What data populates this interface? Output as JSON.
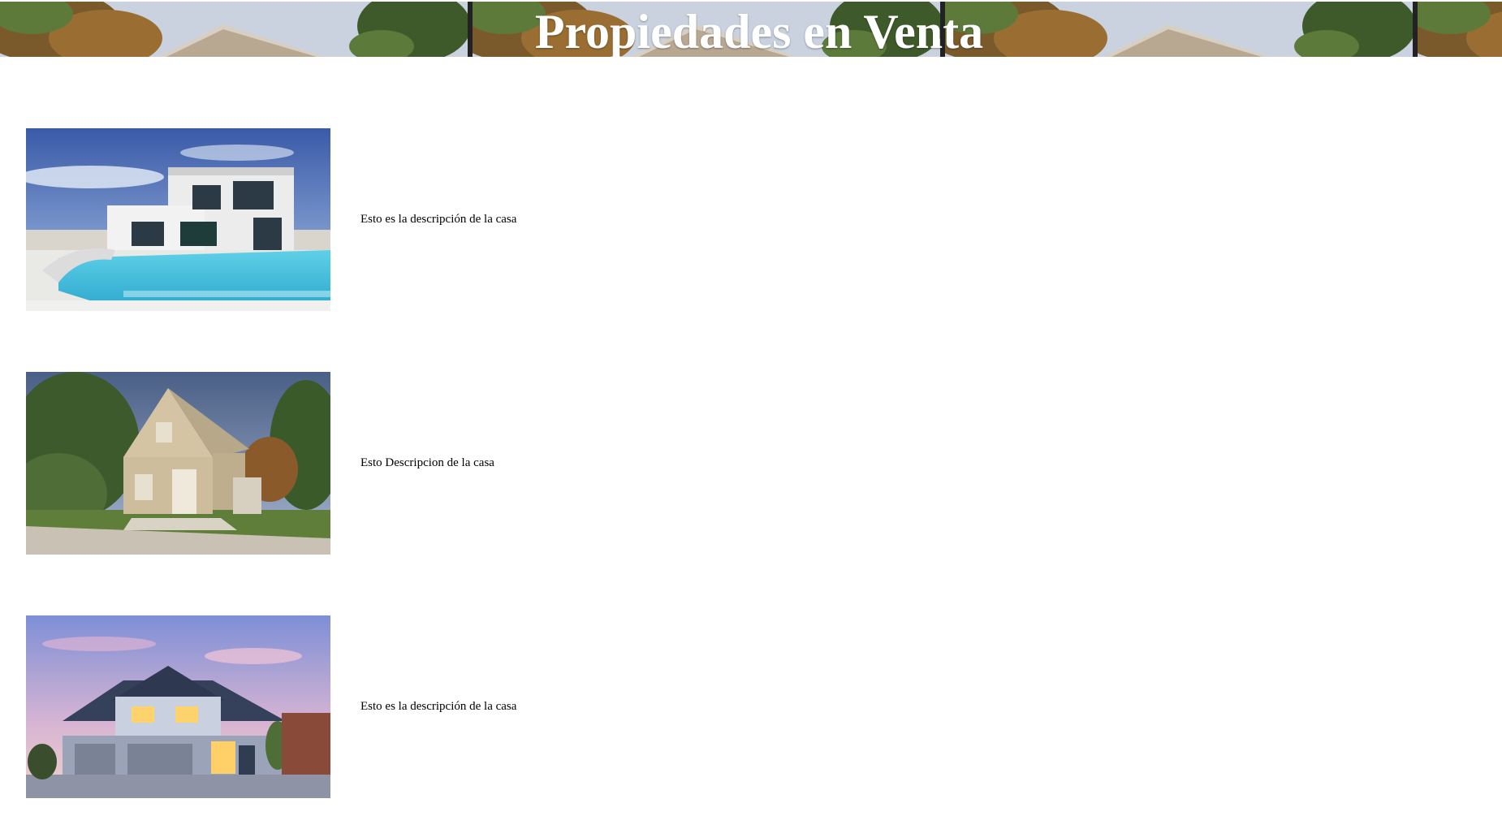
{
  "header": {
    "title": "Propiedades en Venta"
  },
  "listings": [
    {
      "description": "Esto es la descripción de la casa",
      "photo": "modern-house-pool-photo"
    },
    {
      "description": "Esto Descripcion de la casa",
      "photo": "beige-cottage-photo"
    },
    {
      "description": "Esto es la descripción de la casa",
      "photo": "suburban-house-dusk-photo"
    }
  ],
  "colors": {
    "background": "#ffffff",
    "title_text": "#ffffff",
    "body_text": "#000000"
  }
}
